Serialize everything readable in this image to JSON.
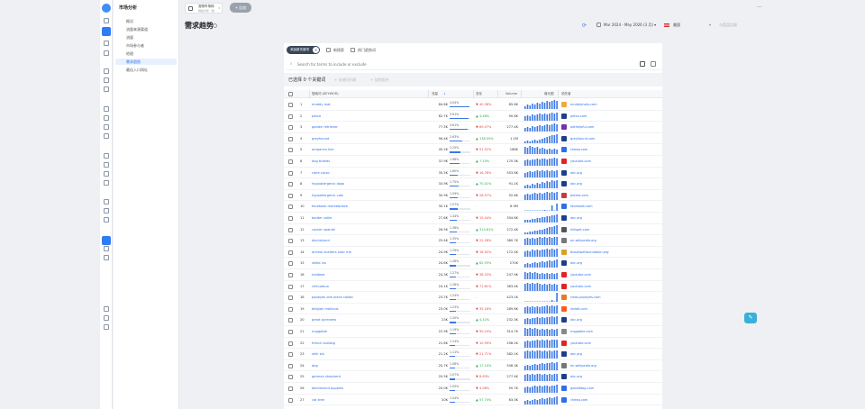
{
  "sidebar": {
    "title": "市场分析",
    "items": [
      {
        "label": "概况"
      },
      {
        "label": "流量来源渠道"
      },
      {
        "label": "流量"
      },
      {
        "label": "市场参与者"
      },
      {
        "label": "地理"
      },
      {
        "label": "需求趋势",
        "active": true
      },
      {
        "label": "最佳入口网址"
      }
    ]
  },
  "header": {
    "project_name": "宠物市场网",
    "project_sub": "网站分析（含",
    "new_button": "+ 比较"
  },
  "toolbar": {
    "page_title": "需求趋势",
    "date_range": "Mar 2024 - May 2026 (3 月) ▾",
    "country": "美国",
    "compare_placeholder": "与竞品比较"
  },
  "filters": {
    "keyword_tag": "添加新关键词",
    "checkbox_1": "新搜索",
    "checkbox_2": "热门趋势词",
    "search_placeholder": "Search for terms to include or exclude"
  },
  "selection": {
    "text": "已选择 0 个关键词",
    "action_1": "+ 关键词列表",
    "action_2": "+ 加到组合"
  },
  "table": {
    "columns": {
      "keyword": "搜索词 (KEYWOR)",
      "traffic": "流量",
      "change": "变化",
      "volume": "Volume",
      "trend": "增长图",
      "domain": "领先者"
    }
  },
  "chart_data": {
    "type": "table",
    "rows": [
      {
        "rank": "1",
        "keyword": "muddy mat",
        "traffic": "84.6K",
        "share": "4.04%",
        "share_value": 4.04,
        "change": "40.36%",
        "dir": "down",
        "volume": "85.6K",
        "trend": [
          3,
          5,
          4,
          6,
          5,
          7,
          6,
          8,
          7,
          9,
          8,
          9,
          10,
          9
        ],
        "domain": "muddymats.com",
        "dcolor": "#f2a93b"
      },
      {
        "rank": "2",
        "keyword": "petco",
        "traffic": "82.7K",
        "share": "3.91%",
        "share_value": 3.91,
        "change": "4.46%",
        "dir": "up",
        "volume": "90.6K",
        "trend": [
          5,
          6,
          5,
          7,
          6,
          7,
          8,
          7,
          8,
          7,
          8,
          9,
          8,
          9
        ],
        "domain": "petco.com",
        "dcolor": "#1d3f8a"
      },
      {
        "rank": "3",
        "keyword": "golden retriever",
        "traffic": "77.5K",
        "share": "3.61%",
        "share_value": 3.61,
        "change": "69.07%",
        "dir": "down",
        "volume": "277.4K",
        "trend": [
          4,
          5,
          4,
          6,
          5,
          6,
          7,
          6,
          7,
          8,
          7,
          8,
          9,
          8
        ],
        "domain": "pethelpful.com",
        "dcolor": "#7b2ea8"
      },
      {
        "rank": "4",
        "keyword": "greyhound",
        "traffic": "56.4K",
        "share": "2.63%",
        "share_value": 2.63,
        "change": "138.05%",
        "dir": "up",
        "volume": "1.1M",
        "trend": [
          2,
          3,
          2,
          3,
          4,
          3,
          4,
          5,
          6,
          7,
          8,
          9,
          9,
          10
        ],
        "domain": "greyhound.com",
        "dcolor": "#1d3f8a"
      },
      {
        "rank": "5",
        "keyword": "amparica line",
        "traffic": "45.2K",
        "share": "2.25%",
        "share_value": 2.25,
        "change": "51.52%",
        "dir": "down",
        "volume": "188K",
        "trend": [
          8,
          7,
          9,
          8,
          7,
          8,
          6,
          7,
          6,
          5,
          6,
          5,
          6,
          5
        ],
        "domain": "chewy.com",
        "dcolor": "#2f6ee6"
      },
      {
        "rank": "6",
        "keyword": "dog breeds",
        "traffic": "37.9K",
        "share": "1.98%",
        "share_value": 1.98,
        "change": "7.10%",
        "dir": "up",
        "volume": "170.3K",
        "trend": [
          6,
          7,
          6,
          7,
          7,
          8,
          7,
          8,
          8,
          7,
          8,
          8,
          9,
          8
        ],
        "domain": "youtube.com",
        "dcolor": "#e02424"
      },
      {
        "rank": "7",
        "keyword": "cane corso",
        "traffic": "35.5K",
        "share": "1.60%",
        "share_value": 1.6,
        "change": "16.78%",
        "dir": "down",
        "volume": "553.6K",
        "trend": [
          5,
          6,
          7,
          6,
          7,
          8,
          7,
          8,
          7,
          8,
          7,
          8,
          7,
          8
        ],
        "domain": "akc.org",
        "dcolor": "#1d3f8a"
      },
      {
        "rank": "8",
        "keyword": "hypoallergenic dogs",
        "traffic": "33.9K",
        "share": "1.75%",
        "share_value": 1.75,
        "change": "70.41%",
        "dir": "up",
        "volume": "91.1K",
        "trend": [
          3,
          4,
          3,
          5,
          4,
          6,
          5,
          7,
          6,
          8,
          7,
          9,
          8,
          9
        ],
        "domain": "akc.org",
        "dcolor": "#1d3f8a"
      },
      {
        "rank": "9",
        "keyword": "hypoallergenic cats",
        "traffic": "30.9K",
        "share": "1.59%",
        "share_value": 1.59,
        "change": "28.97%",
        "dir": "down",
        "volume": "92.8K",
        "trend": [
          6,
          7,
          6,
          7,
          8,
          7,
          8,
          7,
          8,
          9,
          8,
          9,
          8,
          9
        ],
        "domain": "petmd.com",
        "dcolor": "#c43d3d"
      },
      {
        "rank": "10",
        "keyword": "facebook marketplace",
        "traffic": "30.1K",
        "share": "1.57%",
        "share_value": 1.57,
        "change": "",
        "dir": "flat",
        "volume": "8.5M",
        "trend": [
          0,
          0,
          0,
          0,
          0,
          0,
          0,
          0,
          1,
          0,
          0,
          6,
          0,
          8
        ],
        "domain": "facebook.com",
        "dcolor": "#2f6ee6"
      },
      {
        "rank": "11",
        "keyword": "border collie",
        "traffic": "27.6K",
        "share": "1.44%",
        "share_value": 1.44,
        "change": "15.44%",
        "dir": "down",
        "volume": "334.6K",
        "trend": [
          3,
          3,
          3,
          4,
          4,
          5,
          5,
          6,
          6,
          7,
          7,
          8,
          8,
          9
        ],
        "domain": "akc.org",
        "dcolor": "#1d3f8a"
      },
      {
        "rank": "12",
        "keyword": "cocker spaniel",
        "traffic": "26.5K",
        "share": "1.38%",
        "share_value": 1.38,
        "change": "314.61%",
        "dir": "up",
        "volume": "272.4K",
        "trend": [
          2,
          2,
          3,
          3,
          4,
          4,
          5,
          5,
          6,
          7,
          8,
          8,
          9,
          10
        ],
        "domain": "hillspet.com",
        "dcolor": "#555555"
      },
      {
        "rank": "13",
        "keyword": "dachshund",
        "traffic": "25.4K",
        "share": "1.35%",
        "share_value": 1.35,
        "change": "22.28%",
        "dir": "down",
        "volume": "380.7K",
        "trend": [
          7,
          8,
          7,
          8,
          7,
          8,
          9,
          8,
          9,
          8,
          9,
          8,
          9,
          9
        ],
        "domain": "en.wikipedia.org",
        "dcolor": "#777777"
      },
      {
        "rank": "14",
        "keyword": "animal shelters near me",
        "traffic": "24.9K",
        "share": "1.29%",
        "share_value": 1.29,
        "change": "16.92%",
        "dir": "down",
        "volume": "172.4K",
        "trend": [
          6,
          7,
          6,
          8,
          7,
          8,
          7,
          8,
          8,
          9,
          8,
          9,
          8,
          9
        ],
        "domain": "bissellpetfoundation.org",
        "dcolor": "#d6a12a"
      },
      {
        "rank": "15",
        "keyword": "shiba inu",
        "traffic": "24.6K",
        "share": "1.28%",
        "share_value": 1.28,
        "change": "62.93%",
        "dir": "up",
        "volume": "270K",
        "trend": [
          4,
          5,
          4,
          5,
          6,
          5,
          6,
          7,
          6,
          7,
          8,
          7,
          8,
          9
        ],
        "domain": "akc.org",
        "dcolor": "#1d3f8a"
      },
      {
        "rank": "16",
        "keyword": "maltese",
        "traffic": "24.3K",
        "share": "1.27%",
        "share_value": 1.27,
        "change": "38.33%",
        "dir": "down",
        "volume": "247.9K",
        "trend": [
          8,
          7,
          8,
          7,
          8,
          7,
          6,
          7,
          6,
          7,
          6,
          7,
          6,
          7
        ],
        "domain": "youtube.com",
        "dcolor": "#e02424"
      },
      {
        "rank": "17",
        "keyword": "chihuahua",
        "traffic": "24.1K",
        "share": "1.26%",
        "share_value": 1.26,
        "change": "71.61%",
        "dir": "down",
        "volume": "383.4K",
        "trend": [
          8,
          9,
          8,
          9,
          8,
          9,
          8,
          7,
          8,
          7,
          8,
          7,
          8,
          7
        ],
        "domain": "youtube.com",
        "dcolor": "#e02424"
      },
      {
        "rank": "18",
        "keyword": "popeyes one piece collab",
        "traffic": "23.7K",
        "share": "1.24%",
        "share_value": 1.24,
        "change": "",
        "dir": "flat",
        "volume": "423.1K",
        "trend": [
          0,
          0,
          0,
          0,
          0,
          0,
          0,
          0,
          0,
          0,
          0,
          2,
          0,
          10
        ],
        "domain": "news.popeyes.com",
        "dcolor": "#e8792a"
      },
      {
        "rank": "19",
        "keyword": "belgian malinois",
        "traffic": "23.0K",
        "share": "1.23%",
        "share_value": 1.23,
        "change": "35.16%",
        "dir": "down",
        "volume": "289.6K",
        "trend": [
          7,
          8,
          7,
          8,
          7,
          8,
          7,
          8,
          8,
          9,
          8,
          9,
          8,
          9
        ],
        "domain": "reddit.com",
        "dcolor": "#ff5a1f"
      },
      {
        "rank": "20",
        "keyword": "great pyrenees",
        "traffic": "23K",
        "share": "1.20%",
        "share_value": 1.2,
        "change": "4.42%",
        "dir": "up",
        "volume": "232.3K",
        "trend": [
          6,
          7,
          6,
          7,
          7,
          8,
          7,
          8,
          7,
          8,
          8,
          9,
          8,
          9
        ],
        "domain": "akc.org",
        "dcolor": "#1d3f8a"
      },
      {
        "rank": "21",
        "keyword": "nuggable",
        "traffic": "22.9K",
        "share": "1.19%",
        "share_value": 1.19,
        "change": "90.24%",
        "dir": "down",
        "volume": "314.7K",
        "trend": [
          9,
          8,
          9,
          8,
          9,
          8,
          7,
          8,
          7,
          8,
          7,
          8,
          7,
          8
        ],
        "domain": "nuggable.com",
        "dcolor": "#888888"
      },
      {
        "rank": "22",
        "keyword": "french bulldog",
        "traffic": "21.6K",
        "share": "1.14%",
        "share_value": 1.14,
        "change": "10.99%",
        "dir": "down",
        "volume": "258.2K",
        "trend": [
          7,
          8,
          7,
          8,
          8,
          9,
          8,
          9,
          8,
          9,
          8,
          9,
          9,
          9
        ],
        "domain": "youtube.com",
        "dcolor": "#e02424"
      },
      {
        "rank": "23",
        "keyword": "shih tzu",
        "traffic": "21.2K",
        "share": "1.11%",
        "share_value": 1.11,
        "change": "21.71%",
        "dir": "down",
        "volume": "582.1K",
        "trend": [
          8,
          9,
          8,
          9,
          8,
          9,
          9,
          8,
          9,
          8,
          9,
          8,
          9,
          9
        ],
        "domain": "akc.org",
        "dcolor": "#1d3f8a"
      },
      {
        "rank": "24",
        "keyword": "dog",
        "traffic": "20.7K",
        "share": "1.08%",
        "share_value": 1.08,
        "change": "17.10%",
        "dir": "up",
        "volume": "546.3K",
        "trend": [
          5,
          6,
          5,
          6,
          7,
          6,
          7,
          8,
          7,
          8,
          8,
          9,
          8,
          9
        ],
        "domain": "en.wikipedia.org",
        "dcolor": "#777777"
      },
      {
        "rank": "25",
        "keyword": "german shepherd",
        "traffic": "20.5K",
        "share": "1.07%",
        "share_value": 1.07,
        "change": "8.65%",
        "dir": "down",
        "volume": "277.4K",
        "trend": [
          7,
          8,
          7,
          8,
          7,
          8,
          8,
          7,
          8,
          7,
          8,
          7,
          8,
          8
        ],
        "domain": "akc.org",
        "dcolor": "#1d3f8a"
      },
      {
        "rank": "26",
        "keyword": "dachshund puppies",
        "traffic": "20.0K",
        "share": "1.05%",
        "share_value": 1.05,
        "change": "4.98%",
        "dir": "down",
        "volume": "50.7K",
        "trend": [
          6,
          7,
          6,
          7,
          8,
          7,
          8,
          7,
          8,
          8,
          7,
          8,
          8,
          9
        ],
        "domain": "goodddog.com",
        "dcolor": "#2f6ee6"
      },
      {
        "rank": "27",
        "keyword": "cat tree",
        "traffic": "20K",
        "share": "1.04%",
        "share_value": 1.04,
        "change": "57.74%",
        "dir": "up",
        "volume": "63.3K",
        "trend": [
          4,
          5,
          4,
          5,
          6,
          5,
          6,
          7,
          6,
          7,
          8,
          7,
          8,
          9
        ],
        "domain": "chewy.com",
        "dcolor": "#2f6ee6"
      }
    ]
  }
}
